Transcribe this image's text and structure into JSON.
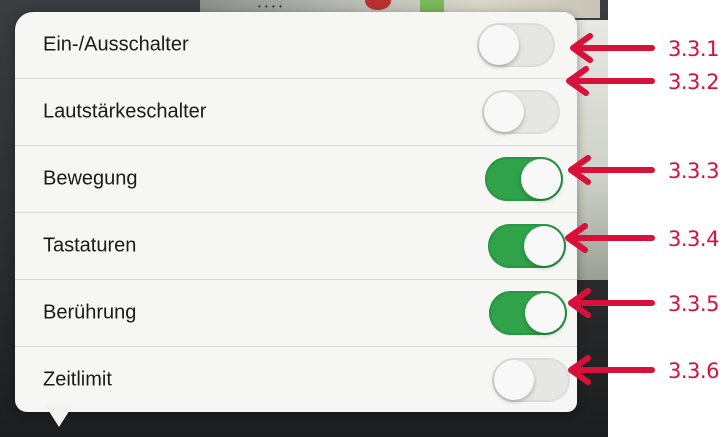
{
  "settings": {
    "rows": [
      {
        "label": "Ein-/Ausschalter",
        "enabled": false
      },
      {
        "label": "Lautstärkeschalter",
        "enabled": false
      },
      {
        "label": "Bewegung",
        "enabled": true
      },
      {
        "label": "Tastaturen",
        "enabled": true
      },
      {
        "label": "Berührung",
        "enabled": true
      },
      {
        "label": "Zeitlimit",
        "enabled": false
      }
    ]
  },
  "annotations": [
    {
      "label": "3.3.1"
    },
    {
      "label": "3.3.2"
    },
    {
      "label": "3.3.3"
    },
    {
      "label": "3.3.4"
    },
    {
      "label": "3.3.5"
    },
    {
      "label": "3.3.6"
    }
  ],
  "colors": {
    "toggle_on": "#2fa24a",
    "toggle_off": "#e6e6e4",
    "annotation": "#d8103a"
  },
  "icons": {
    "annotation_arrow": "left-arrow-icon"
  }
}
